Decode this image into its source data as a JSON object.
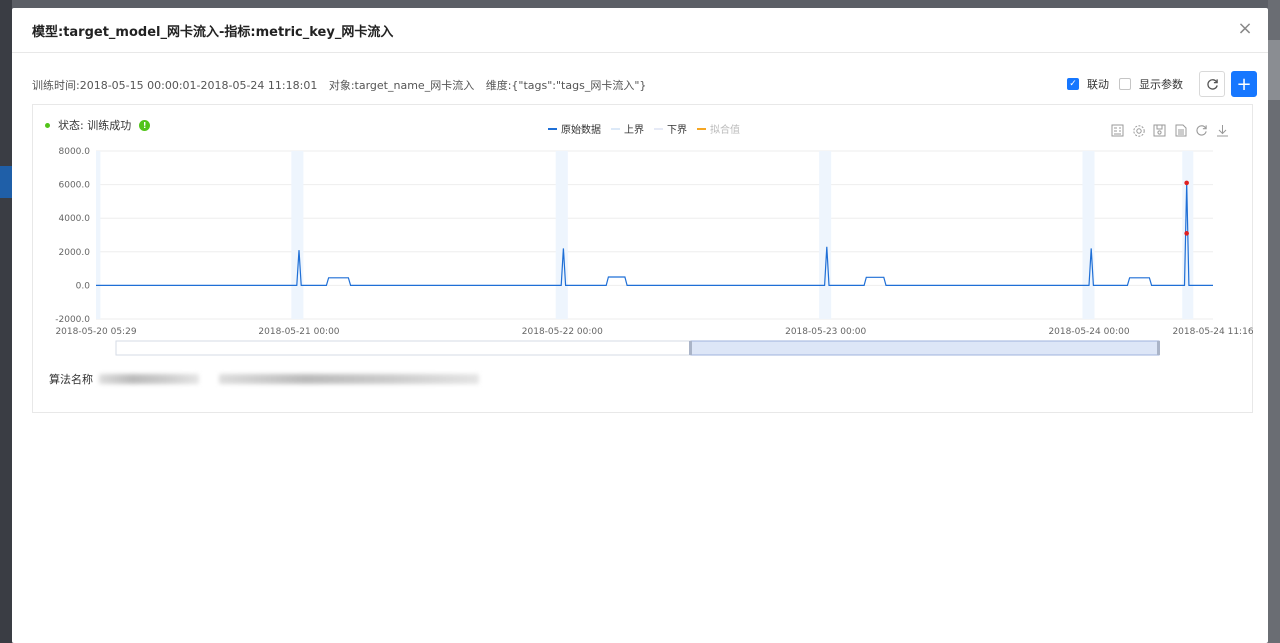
{
  "modal": {
    "title": "模型:target_model_网卡流入-指标:metric_key_网卡流入",
    "close": "×"
  },
  "info": {
    "train_time": "训练时间:2018-05-15 00:00:01-2018-05-24 11:18:01",
    "object": "对象:target_name_网卡流入",
    "dimension": "维度:{\"tags\":\"tags_网卡流入\"}"
  },
  "controls": {
    "link_label": "联动",
    "link_checked": true,
    "show_params_label": "显示参数",
    "show_params_checked": false,
    "refresh_icon": "refresh-icon",
    "add_icon": "plus-icon"
  },
  "status": {
    "text": "状态: 训练成功"
  },
  "legend": [
    "原始数据",
    "上界",
    "下界",
    "拟合值"
  ],
  "algo": {
    "label": "算法名称"
  },
  "toolbox_icons": [
    "data-view-icon",
    "settings-icon",
    "save-icon",
    "doc-icon",
    "restore-icon",
    "download-icon"
  ],
  "colors": {
    "primary": "#1677ff",
    "series_raw": "#1f6fd6",
    "series_upper": "#dce9f8",
    "series_lower": "#e6eaf6",
    "series_fit": "#f5a623",
    "anomaly": "#e02020",
    "success": "#52c41a"
  },
  "chart_data": {
    "type": "line",
    "ylim": [
      -2000,
      8000
    ],
    "yticks": [
      "8000.0",
      "6000.0",
      "4000.0",
      "2000.0",
      "0.0",
      "-2000.0"
    ],
    "xticks": [
      "2018-05-20 05:29",
      "2018-05-21 00:00",
      "2018-05-22 00:00",
      "2018-05-23 00:00",
      "2018-05-24 00:00",
      "2018-05-24 11:16"
    ],
    "x_range_hours": [
      0,
      101.8
    ],
    "series": [
      {
        "name": "原始数据",
        "points": [
          [
            0,
            0
          ],
          [
            18.3,
            0
          ],
          [
            18.5,
            2100
          ],
          [
            18.7,
            0
          ],
          [
            21,
            0
          ],
          [
            21.2,
            450
          ],
          [
            23,
            450
          ],
          [
            23.2,
            0
          ],
          [
            42.4,
            0
          ],
          [
            42.6,
            2200
          ],
          [
            42.8,
            0
          ],
          [
            46.5,
            0
          ],
          [
            46.7,
            500
          ],
          [
            48.2,
            500
          ],
          [
            48.4,
            0
          ],
          [
            66.4,
            0
          ],
          [
            66.6,
            2300
          ],
          [
            66.8,
            0
          ],
          [
            70,
            0
          ],
          [
            70.2,
            480
          ],
          [
            71.8,
            480
          ],
          [
            72,
            0
          ],
          [
            90.5,
            0
          ],
          [
            90.7,
            2200
          ],
          [
            90.9,
            0
          ],
          [
            94,
            0
          ],
          [
            94.2,
            450
          ],
          [
            96,
            450
          ],
          [
            96.2,
            0
          ],
          [
            99.2,
            0
          ],
          [
            99.4,
            6100
          ],
          [
            99.6,
            0
          ],
          [
            101.8,
            0
          ]
        ]
      },
      {
        "name": "上界",
        "points": []
      },
      {
        "name": "下界",
        "points": []
      },
      {
        "name": "拟合值",
        "points": []
      }
    ],
    "anomalies": [
      [
        99.4,
        6100
      ],
      [
        99.4,
        3100
      ]
    ]
  }
}
